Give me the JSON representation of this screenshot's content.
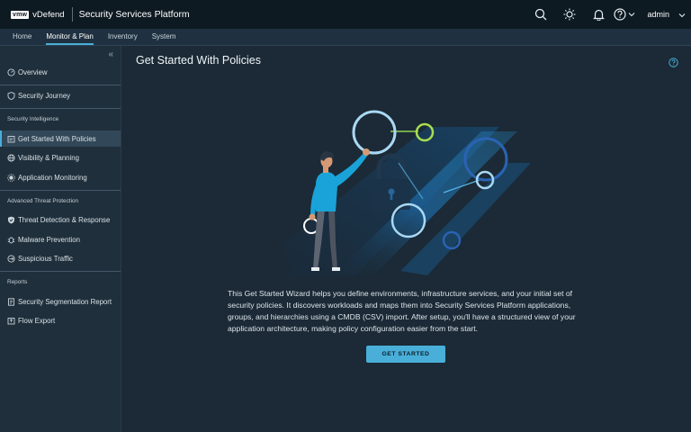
{
  "header": {
    "logo_text": "vmw",
    "brand": "vDefend",
    "app_title": "Security Services Platform",
    "user": "admin",
    "icons": [
      "search-icon",
      "theme-icon",
      "bell-icon",
      "help-icon",
      "chevron-down-icon"
    ]
  },
  "nav": {
    "tabs": [
      {
        "label": "Home",
        "active": false
      },
      {
        "label": "Monitor & Plan",
        "active": true
      },
      {
        "label": "Inventory",
        "active": false
      },
      {
        "label": "System",
        "active": false
      }
    ]
  },
  "sidebar": {
    "collapse_glyph": "«",
    "overview": "Overview",
    "security_journey": "Security Journey",
    "section_intel": "Security Intelligence",
    "get_started": "Get Started With Policies",
    "visibility": "Visibility & Planning",
    "app_monitoring": "Application Monitoring",
    "section_threat": "Advanced Threat Protection",
    "threat_detection": "Threat Detection & Response",
    "malware": "Malware Prevention",
    "suspicious": "Suspicious Traffic",
    "section_reports": "Reports",
    "segmentation_report": "Security Segmentation Report",
    "flow_export": "Flow Export",
    "active_item": "Get Started With Policies"
  },
  "main": {
    "title": "Get Started With Policies",
    "description": "This Get Started Wizard helps you define environments, infrastructure services, and your initial set of security policies. It discovers workloads and maps them into Security Services Platform applications, groups, and hierarchies using a CMDB (CSV) import. After setup, you'll have a structured view of your application architecture, making policy configuration easier from the start.",
    "cta": "GET STARTED"
  },
  "colors": {
    "accent": "#49afd9",
    "header_bg": "#0e1a22",
    "sidebar_bg": "#1f2f3b",
    "main_bg": "#1b2a36",
    "green": "#8fd14f"
  }
}
